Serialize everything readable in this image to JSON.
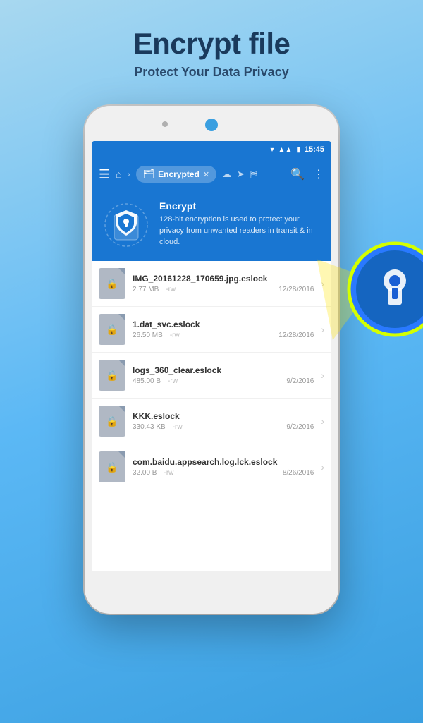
{
  "header": {
    "title": "Encrypt file",
    "subtitle": "Protect Your Data Privacy"
  },
  "statusBar": {
    "time": "15:45",
    "icons": [
      "wifi",
      "signal",
      "battery"
    ]
  },
  "appBar": {
    "breadcrumb_label": "Encrypted",
    "search_label": "Search",
    "more_label": "More"
  },
  "banner": {
    "title": "Encrypt",
    "description": "128-bit encryption is used to protect your privacy from unwanted readers in transit & in cloud."
  },
  "files": [
    {
      "name": "IMG_20161228_170659.jpg.eslock",
      "size": "2.77 MB",
      "perm": "-rw",
      "date": "12/28/2016"
    },
    {
      "name": "1.dat_svc.eslock",
      "size": "26.50 MB",
      "perm": "-rw",
      "date": "12/28/2016"
    },
    {
      "name": "logs_360_clear.eslock",
      "size": "485.00 B",
      "perm": "-rw",
      "date": "9/2/2016"
    },
    {
      "name": "KKK.eslock",
      "size": "330.43 KB",
      "perm": "-rw",
      "date": "9/2/2016"
    },
    {
      "name": "com.baidu.appsearch.log.lck.eslock",
      "size": "32.00 B",
      "perm": "-rw",
      "date": "8/26/2016"
    }
  ]
}
